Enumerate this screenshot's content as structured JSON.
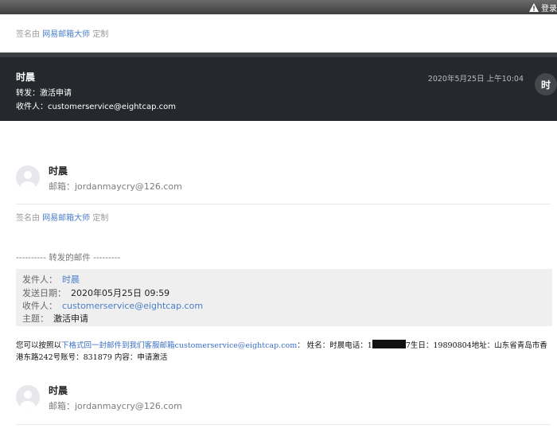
{
  "topbar": {
    "alert_label": "登录",
    "warning_icon": "warning-triangle-icon"
  },
  "signature": {
    "prefix": "签名由",
    "brand": "网易邮箱大师",
    "suffix": "定制"
  },
  "header": {
    "sender_name": "时晨",
    "forward_label": "转发：",
    "forward_subject": "激活申请",
    "to_label": "收件人：",
    "to_email": "customerservice@eightcap.com",
    "date": "2020年5月25日 上午10:04",
    "avatar_char": "时"
  },
  "contact_card": {
    "name": "时晨",
    "email_label": "邮箱：",
    "email": "jordanmaycry@126.com"
  },
  "forwarded": {
    "title": "---------- 转发的邮件 ---------",
    "from_label": "发件人：",
    "from_value": "时晨",
    "date_label": "发送日期：",
    "date_value": "2020年05月25日 09:59",
    "to_label": "收件人：",
    "to_value": "customerservice@eightcap.com",
    "subject_label": "主题：",
    "subject_value": "激活申请"
  },
  "body": {
    "intro": "您可以按照以",
    "link_text": "下格式回一封邮件到我们客服邮箱customerservice@eightcap.com",
    "after_link": "： 姓名：时晨电话：",
    "phone_prefix": "1",
    "after_redact": "7生日：19890804地址：山东省青岛市香港东路242号账号：831879 内容：申请激活"
  },
  "contact_card_2": {
    "name": "时晨",
    "email_label": "邮箱：",
    "email": "jordanmaycry@126.com"
  },
  "colors": {
    "header_bg": "#25282c",
    "link": "#4a7ec9",
    "box_bg": "#efefef"
  }
}
